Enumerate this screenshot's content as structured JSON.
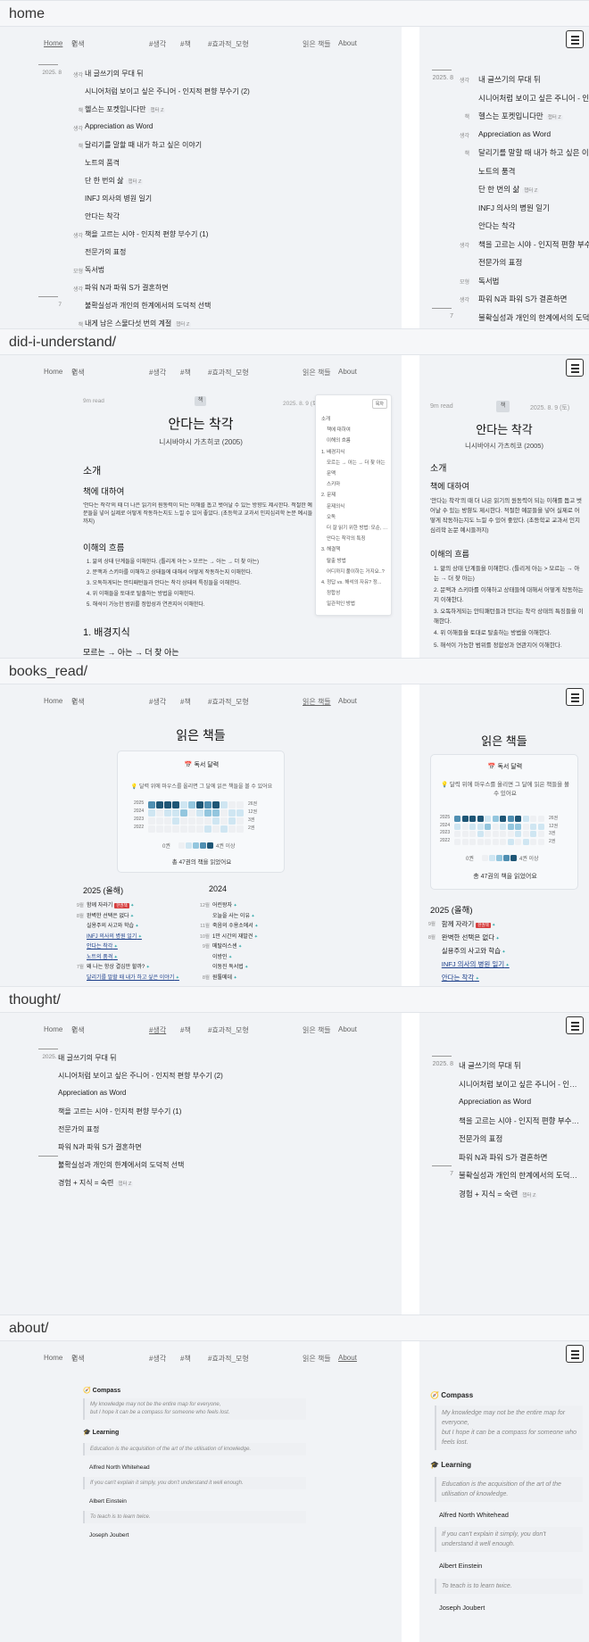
{
  "nav": {
    "home": "Home",
    "search": "검색",
    "tag_thought": "#생각",
    "tag_book": "#책",
    "tag_effective": "#효과적_모형",
    "books_read": "읽은 책들",
    "about": "About"
  },
  "sections": {
    "home": "home",
    "did": "did-i-understand/",
    "books": "books_read/",
    "thought": "thought/",
    "about": "about/"
  },
  "home_posts": [
    {
      "date": "2025. 8",
      "cat": "생각",
      "title": "내 글쓰기의 무대 뒤",
      "badge": ""
    },
    {
      "date": "",
      "cat": "",
      "title": "시니어처럼 보이고 싶은 주니어 - 인지적 편향 부수기 (2)",
      "badge": ""
    },
    {
      "date": "",
      "cat": "책",
      "title": "헬스는 포켓입니다만",
      "badge": "챕터 Z"
    },
    {
      "date": "",
      "cat": "생각",
      "title": "Appreciation as Word",
      "badge": ""
    },
    {
      "date": "",
      "cat": "책",
      "title": "달리기를 말할 때 내가 하고 싶은 이야기",
      "badge": ""
    },
    {
      "date": "",
      "cat": "",
      "title": "노트의 품격",
      "badge": ""
    },
    {
      "date": "",
      "cat": "",
      "title": "단 한 번의 삶",
      "badge": "챕터 Z"
    },
    {
      "date": "",
      "cat": "",
      "title": "INFJ 의사의 병원 일기",
      "badge": ""
    },
    {
      "date": "",
      "cat": "",
      "title": "안다는 착각",
      "badge": ""
    },
    {
      "date": "",
      "cat": "생각",
      "title": "책을 고르는 시야 - 인지적 편향 부수기 (1)",
      "badge": ""
    },
    {
      "date": "",
      "cat": "",
      "title": "전문가의 표정",
      "badge": ""
    },
    {
      "date": "",
      "cat": "모형",
      "title": "독서법",
      "badge": ""
    },
    {
      "date": "",
      "cat": "생각",
      "title": "파워 N과 파워 S가 결혼하면",
      "badge": ""
    },
    {
      "date": "7",
      "cat": "",
      "title": "불확실성과 개인의 한계에서의 도덕적 선택",
      "badge": ""
    },
    {
      "date": "",
      "cat": "책",
      "title": "내게 남은 스물다섯 번의 계절",
      "badge": "챕터 Z"
    }
  ],
  "thought_posts": [
    {
      "date": "2025. 8",
      "title": "내 글쓰기의 무대 뒤",
      "badge": ""
    },
    {
      "date": "",
      "title": "시니어처럼 보이고 싶은 주니어 - 인지적 편향 부수기 (2)",
      "badge": ""
    },
    {
      "date": "",
      "title": "Appreciation as Word",
      "badge": ""
    },
    {
      "date": "",
      "title": "책을 고르는 시야 - 인지적 편향 부수기 (1)",
      "badge": ""
    },
    {
      "date": "",
      "title": "전문가의 표정",
      "badge": ""
    },
    {
      "date": "",
      "title": "파워 N과 파워 S가 결혼하면",
      "badge": ""
    },
    {
      "date": "7",
      "title": "불확실성과 개인의 한계에서의 도덕적 선택",
      "badge": ""
    },
    {
      "date": "",
      "title": "경험 + 지식 = 숙련",
      "badge": "챕터 Z"
    }
  ],
  "article": {
    "read": "9m read",
    "tag": "책",
    "date": "2025. 8. 9 (토)",
    "title": "안다는 착각",
    "author": "니시바야시 가츠히코 (2005)",
    "h_intro": "소개",
    "h_about": "책에 대하여",
    "p1": "'안다는 착각'의 때 더 나은 읽기의 원동력이 되는 이해를 돕고 벗어날 수 있는 방향도 제시한다. 적절한 예문들을 넣어 실제로 어떻게 작동하는지도 느낄 수 있어 좋았다. (초등학교 교과서 인지심리학 논문 예시들까지)",
    "p1_short": "'안다는 착각'의 때 더 나은 읽기의 원동력이 되는 이해를 돕고 벗어날 수 있는 방향도 제시한다. 적절한 예문들을 넣어 실제로 어떻게 작동하는지도 느낄 수 있어 좋았다. (초등학교 교과서 인지심리학 논문 예시들까지)",
    "h_flow": "이해의 흐름",
    "flow": [
      "1. 앎의 상태 단계들을 이해한다. (틀리게 아는 > 모르는 → 아는 → 더 찾 아는)",
      "2. 문맥과 스키마를 이해하고 상태들에 대해서 어떻게 작동하는지 이해한다.",
      "3. 오독하게되는 안티패턴들과 안다는 착각 상태의 특징들을 이해한다.",
      "4. 위 이해들을 토대로 탈출하는 방법을 이해한다.",
      "5. 해석이 가능한 범위를 정합성과 연관지어 이해한다."
    ],
    "h_bg": "1. 배경지식",
    "bg_sub": "모르는 → 아는 → 더 찾 아는"
  },
  "toc": {
    "button": "목차",
    "items": [
      "소개",
      "책에 대하여",
      "이해의 흐름",
      "1. 배경지식",
      "모르는 → 아는 → 더 찾 아는",
      "문맥",
      "스키마",
      "2. 문제",
      "문제의식",
      "오독",
      "더 잘 읽기 위한 방법: 모순, 미...",
      "안다는 착각의 특징",
      "3. 해결책",
      "탈출 방법",
      "어디까지 풀이하는 거지요..?",
      "4. 정답 vs. 해석의 자유? 정...",
      "정합성",
      "일관적인 방법"
    ]
  },
  "books": {
    "page_title": "읽은 책들",
    "card_title": "📅 독서 달력",
    "card_hint": "💡 달력 위에 마우스를 올리면 그 달에 읽은 책들을 볼 수 있어요",
    "years": [
      "2025",
      "2024",
      "2023",
      "2022"
    ],
    "counts": [
      "26권",
      "12권",
      "3권",
      "2권"
    ],
    "legend_min": "0권",
    "legend_max": "4권 이상",
    "total": "총 47권의 책을 읽었어요",
    "h_2025": "2025 (올해)",
    "h_2024": "2024",
    "list_2025": [
      {
        "mo": "9월",
        "name": "함께 자라기",
        "kb": "한권책",
        "link": false
      },
      {
        "mo": "8월",
        "name": "완벽한 선택은 없다",
        "kb": "",
        "link": false
      },
      {
        "mo": "",
        "name": "실용주의 사고와 학습",
        "kb": "",
        "link": false
      },
      {
        "mo": "",
        "name": "INFJ 의사의 병원 일기",
        "kb": "",
        "link": true
      },
      {
        "mo": "",
        "name": "안다는 착각",
        "kb": "",
        "link": true
      },
      {
        "mo": "",
        "name": "노트의 품격",
        "kb": "",
        "link": true
      },
      {
        "mo": "7월",
        "name": "왜 나는 항상 결심만 할까?",
        "kb": "",
        "link": false
      },
      {
        "mo": "",
        "name": "달리기를 말할 때 내가 하고 싶은 이야기",
        "kb": "",
        "link": true
      }
    ],
    "list_2024": [
      {
        "mo": "12월",
        "name": "어린왕자"
      },
      {
        "mo": "",
        "name": "오늘을 사는 이유"
      },
      {
        "mo": "11월",
        "name": "죽음의 수용소에서"
      },
      {
        "mo": "10월",
        "name": "1만 시간의 재발견"
      },
      {
        "mo": "9월",
        "name": "메탈러스센"
      },
      {
        "mo": "",
        "name": "이방인"
      },
      {
        "mo": "",
        "name": "이동진 독서법"
      },
      {
        "mo": "8월",
        "name": "원툴메데"
      }
    ]
  },
  "about": {
    "compass": "Compass",
    "compass_quote_1": "My knowledge may not be the entire map for everyone,",
    "compass_quote_2": "but I hope it can be a compass for someone who feels lost.",
    "m_compass_1": "My knowledge may not be the entire map for everyone,",
    "m_compass_2": "but I hope it can be a compass for someone who feels lost.",
    "learning": "Learning",
    "q1": "Education is the acquisition of the art of the utilisation of knowledge.",
    "a1": "Alfred North Whitehead",
    "q2": "If you can't explain it simply, you don't understand it well enough.",
    "a2": "Albert Einstein",
    "q3": "To teach is to learn twice.",
    "a3": "Joseph Joubert"
  }
}
